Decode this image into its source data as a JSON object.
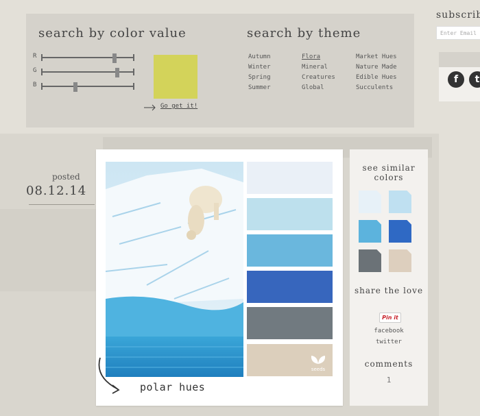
{
  "search_color": {
    "title": "search by color value",
    "sliders": [
      {
        "label": "R",
        "value": 0.8
      },
      {
        "label": "G",
        "value": 0.83
      },
      {
        "label": "B",
        "value": 0.37
      }
    ],
    "preview_color": "#d3d35a",
    "go_label": "Go get it!"
  },
  "search_theme": {
    "title": "search by theme",
    "columns": [
      [
        "Autumn",
        "Winter",
        "Spring",
        "Summer"
      ],
      [
        "Flora",
        "Mineral",
        "Creatures",
        "Global"
      ],
      [
        "Market Hues",
        "Nature Made",
        "Edible Hues",
        "Succulents"
      ]
    ],
    "active": "Flora"
  },
  "subscribe": {
    "title": "subscribe",
    "email_placeholder": "Enter Email",
    "social": [
      "facebook-icon",
      "twitter-icon"
    ]
  },
  "post": {
    "posted_label": "posted",
    "date": "08.12.14",
    "caption": "polar hues",
    "swatches": [
      "#eaf0f7",
      "#bde0ed",
      "#6ab7dd",
      "#3766bd",
      "#717a80",
      "#dccfbc"
    ],
    "logo_text": "seeds"
  },
  "sidebar": {
    "similar_title": "see similar colors",
    "similar_colors": [
      "#e7f1f8",
      "#bfe0f1",
      "#5cb3dd",
      "#2f69c4",
      "#6b7277",
      "#ddcfbe"
    ],
    "share_title": "share the love",
    "pinit_label": "Pin it",
    "facebook_label": "facebook",
    "twitter_label": "twitter",
    "comments_title": "comments",
    "comments_count": "1"
  }
}
